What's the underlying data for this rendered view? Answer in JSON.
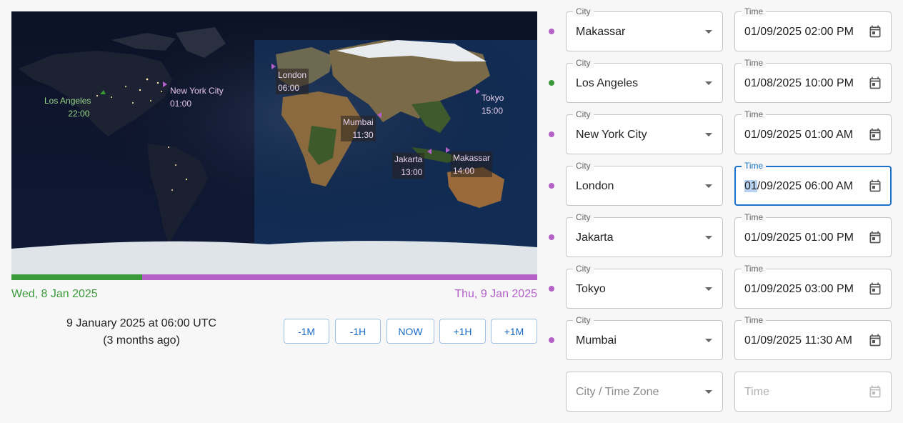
{
  "colors": {
    "green": "#3a9a3a",
    "purple": "#b55fc9",
    "accent_blue": "#1a73c9"
  },
  "map": {
    "labels": [
      {
        "name": "Los Angeles",
        "time": "22:00",
        "color": "green"
      },
      {
        "name": "New York City",
        "time": "01:00",
        "color": "purple"
      },
      {
        "name": "London",
        "time": "06:00",
        "color": "purple"
      },
      {
        "name": "Tokyo",
        "time": "15:00",
        "color": "purple"
      },
      {
        "name": "Mumbai",
        "time": "11:30",
        "color": "purple"
      },
      {
        "name": "Jakarta",
        "time": "13:00",
        "color": "purple"
      },
      {
        "name": "Makassar",
        "time": "14:00",
        "color": "purple"
      }
    ]
  },
  "timeline": {
    "left_date": "Wed, 8 Jan 2025",
    "right_date": "Thu, 9 Jan 2025"
  },
  "utc": {
    "line1": "9 January 2025 at 06:00 UTC",
    "line2": "(3 months ago)"
  },
  "controls": [
    "-1M",
    "-1H",
    "NOW",
    "+1H",
    "+1M"
  ],
  "rows": [
    {
      "city_label": "City",
      "city": "Makassar",
      "time_label": "Time",
      "time": "01/09/2025 02:00 PM",
      "dot": "purple"
    },
    {
      "city_label": "City",
      "city": "Los Angeles",
      "time_label": "Time",
      "time": "01/08/2025 10:00 PM",
      "dot": "green"
    },
    {
      "city_label": "City",
      "city": "New York City",
      "time_label": "Time",
      "time": "01/09/2025 01:00 AM",
      "dot": "purple"
    },
    {
      "city_label": "City",
      "city": "London",
      "time_label": "Time",
      "time_sel": "01",
      "time_rest": "/09/2025 06:00 AM",
      "dot": "purple"
    },
    {
      "city_label": "City",
      "city": "Jakarta",
      "time_label": "Time",
      "time": "01/09/2025 01:00 PM",
      "dot": "purple"
    },
    {
      "city_label": "City",
      "city": "Tokyo",
      "time_label": "Time",
      "time": "01/09/2025 03:00 PM",
      "dot": "purple"
    },
    {
      "city_label": "City",
      "city": "Mumbai",
      "time_label": "Time",
      "time": "01/09/2025 11:30 AM",
      "dot": "purple"
    }
  ],
  "new_row": {
    "city_placeholder": "City / Time Zone",
    "time_placeholder": "Time"
  }
}
